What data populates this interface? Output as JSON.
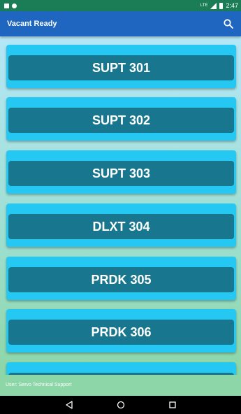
{
  "status_bar": {
    "time": "2:47",
    "network_label": "LTE"
  },
  "app_bar": {
    "title": "Vacant Ready",
    "search_icon": "search-icon"
  },
  "units": [
    {
      "label": "SUPT 301"
    },
    {
      "label": "SUPT 302"
    },
    {
      "label": "SUPT 303"
    },
    {
      "label": "DLXT 304"
    },
    {
      "label": "PRDK 305"
    },
    {
      "label": "PRDK 306"
    },
    {
      "label": ""
    }
  ],
  "footer": {
    "user_text": "User: Servo Technical Support"
  },
  "nav_bar": {
    "back_icon": "back-icon",
    "home_icon": "home-icon",
    "recents_icon": "recents-icon"
  },
  "colors": {
    "status_bar": "#1a7d55",
    "app_bar": "#1f66c0",
    "card": "#25c8f2",
    "card_button": "#18778e",
    "background_top": "#b4e6f7",
    "background_bottom": "#8dd6a7"
  }
}
